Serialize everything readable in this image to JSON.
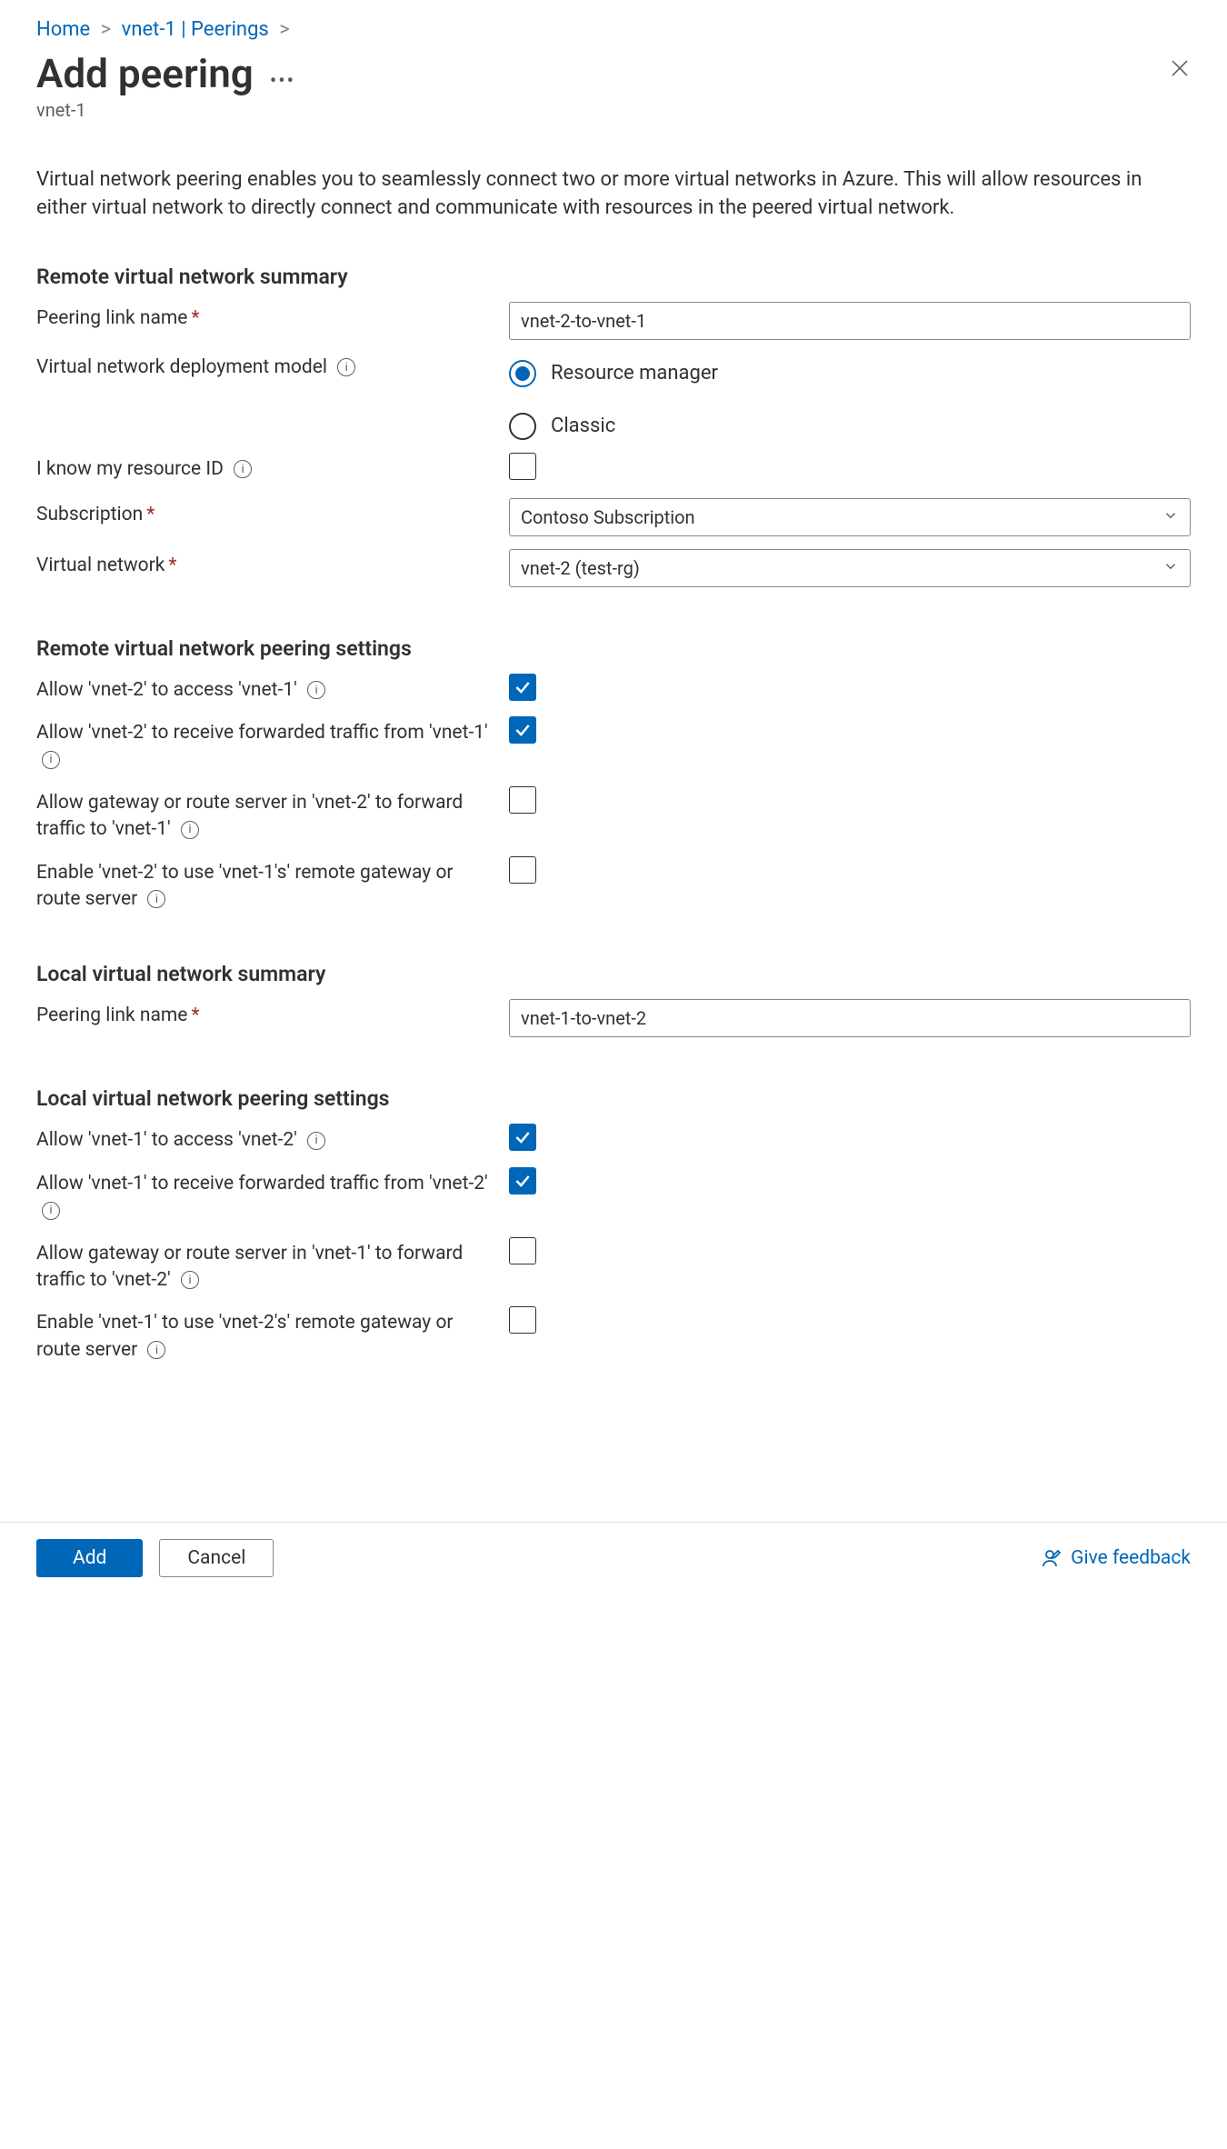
{
  "breadcrumb": {
    "items": [
      {
        "label": "Home"
      },
      {
        "label": "vnet-1 | Peerings"
      }
    ]
  },
  "header": {
    "title": "Add peering",
    "subtitle": "vnet-1"
  },
  "intro": "Virtual network peering enables you to seamlessly connect two or more virtual networks in Azure. This will allow resources in either virtual network to directly connect and communicate with resources in the peered virtual network.",
  "sections": {
    "remoteSummary": "Remote virtual network summary",
    "remoteSettings": "Remote virtual network peering settings",
    "localSummary": "Local virtual network summary",
    "localSettings": "Local virtual network peering settings"
  },
  "remote": {
    "peeringLinkNameLabel": "Peering link name",
    "peeringLinkNameValue": "vnet-2-to-vnet-1",
    "deploymentModelLabel": "Virtual network deployment model",
    "deploymentOptions": {
      "resourceManager": "Resource manager",
      "classic": "Classic",
      "selected": "resourceManager"
    },
    "knowResourceIdLabel": "I know my resource ID",
    "knowResourceIdChecked": false,
    "subscriptionLabel": "Subscription",
    "subscriptionValue": "Contoso Subscription",
    "virtualNetworkLabel": "Virtual network",
    "virtualNetworkValue": "vnet-2 (test-rg)"
  },
  "remotePeering": {
    "allowAccess": {
      "label": "Allow 'vnet-2' to access 'vnet-1'",
      "checked": true
    },
    "allowForwarded": {
      "label": "Allow 'vnet-2' to receive forwarded traffic from 'vnet-1'",
      "checked": true
    },
    "allowGateway": {
      "label": "Allow gateway or route server in 'vnet-2' to forward traffic to 'vnet-1'",
      "checked": false
    },
    "useRemoteGateway": {
      "label": "Enable 'vnet-2' to use 'vnet-1's' remote gateway or route server",
      "checked": false
    }
  },
  "local": {
    "peeringLinkNameLabel": "Peering link name",
    "peeringLinkNameValue": "vnet-1-to-vnet-2"
  },
  "localPeering": {
    "allowAccess": {
      "label": "Allow 'vnet-1' to access 'vnet-2'",
      "checked": true
    },
    "allowForwarded": {
      "label": "Allow 'vnet-1' to receive forwarded traffic from 'vnet-2'",
      "checked": true
    },
    "allowGateway": {
      "label": "Allow gateway or route server in 'vnet-1' to forward traffic to 'vnet-2'",
      "checked": false
    },
    "useRemoteGateway": {
      "label": "Enable 'vnet-1' to use 'vnet-2's' remote gateway or route server",
      "checked": false
    }
  },
  "footer": {
    "add": "Add",
    "cancel": "Cancel",
    "feedback": "Give feedback"
  }
}
